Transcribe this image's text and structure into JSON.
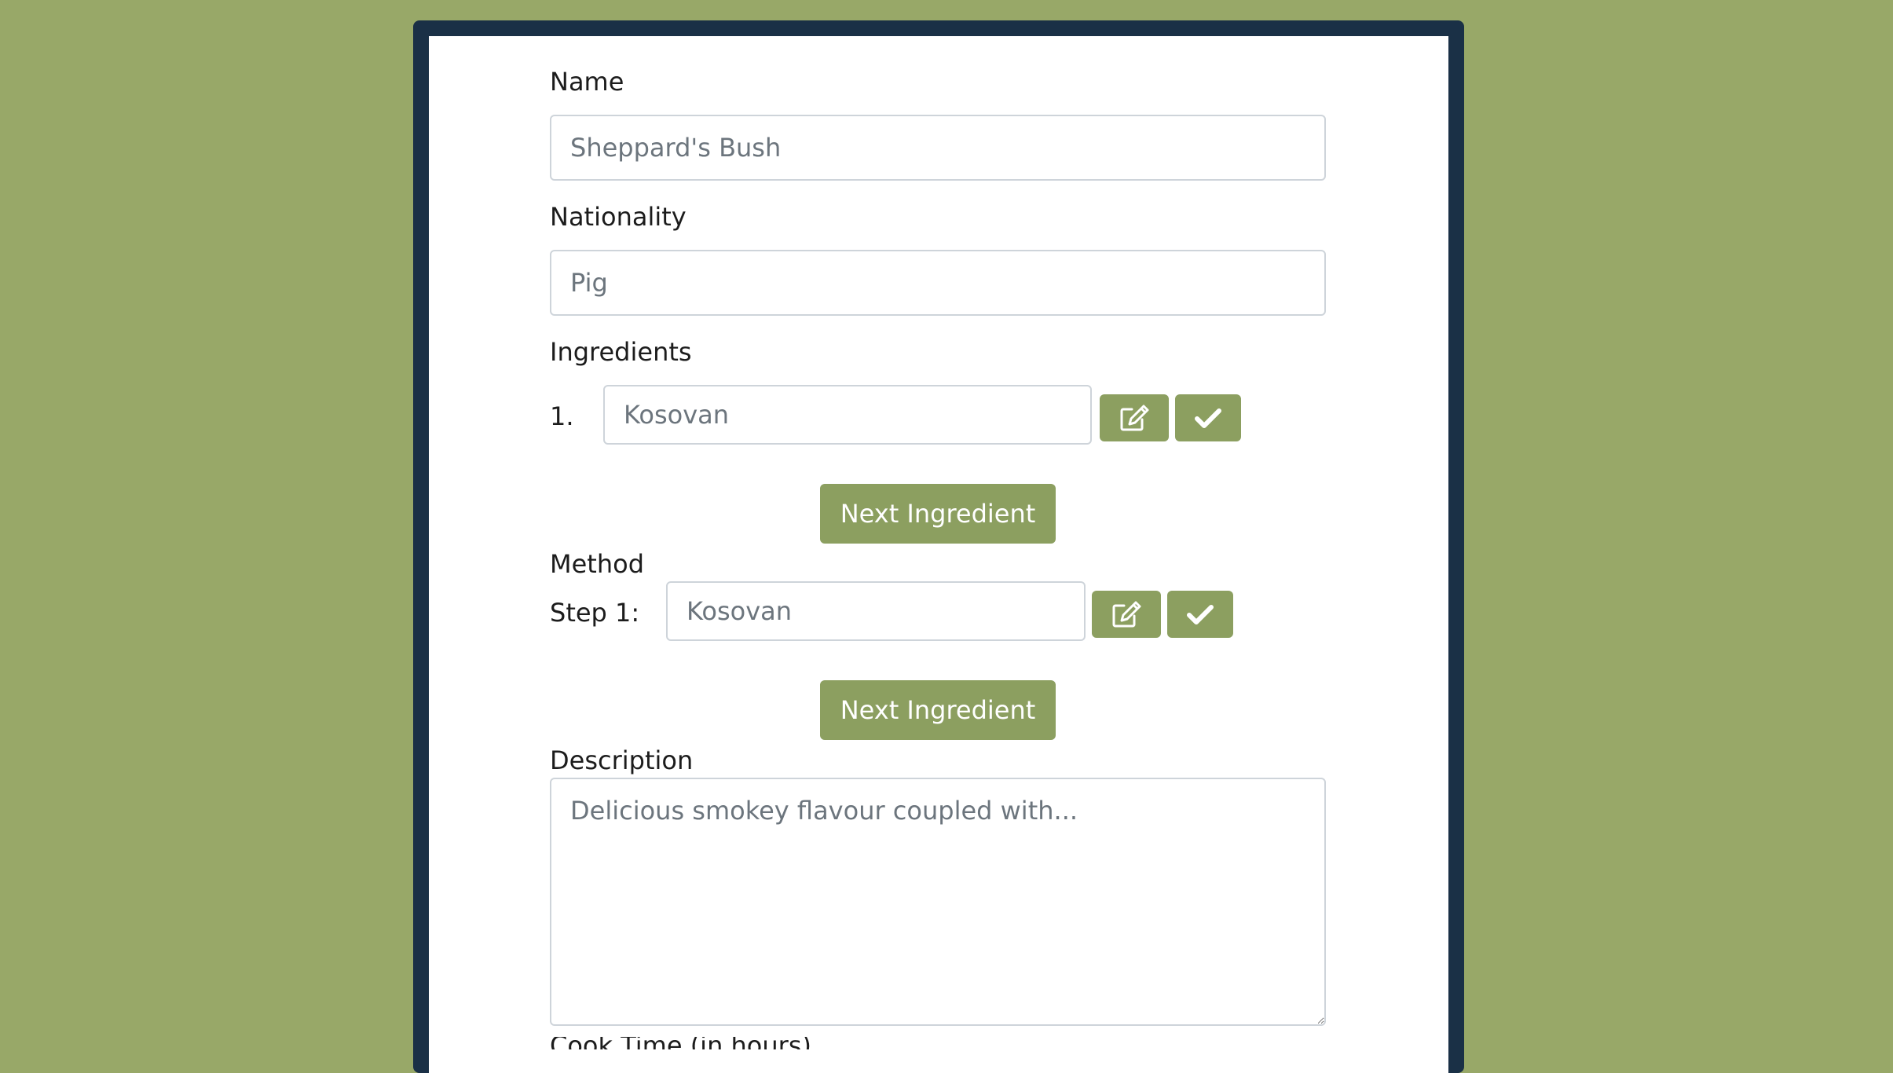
{
  "form": {
    "name_label": "Name",
    "name_placeholder": "Sheppard's Bush",
    "nationality_label": "Nationality",
    "nationality_placeholder": "Pig",
    "ingredients_label": "Ingredients",
    "ingredient": {
      "number": "1.",
      "placeholder": "Kosovan",
      "edit_icon": "edit-icon",
      "confirm_icon": "check-icon"
    },
    "next_ingredient_label": "Next Ingredient",
    "method_label": "Method",
    "step": {
      "label": "Step 1:",
      "placeholder": "Kosovan",
      "edit_icon": "edit-icon",
      "confirm_icon": "check-icon"
    },
    "next_step_label": "Next Ingredient",
    "description_label": "Description",
    "description_placeholder": "Delicious smokey flavour coupled with...",
    "cook_time_label": "Cook Time (in hours)"
  },
  "colors": {
    "background": "#98a868",
    "frame": "#1a3046",
    "button": "#8c9f60"
  }
}
